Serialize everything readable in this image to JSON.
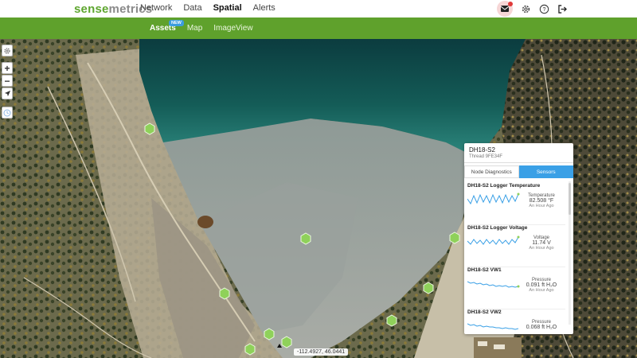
{
  "header": {
    "logo_part1": "sense",
    "logo_part2": "metrics",
    "nav": [
      "Network",
      "Data",
      "Spatial",
      "Alerts"
    ],
    "active_nav": "Spatial"
  },
  "subnav": {
    "items": [
      "Assets",
      "Map",
      "ImageView"
    ],
    "active": "Assets",
    "badge": "NEW"
  },
  "map": {
    "coordinates": "-112.4927, 46.0441",
    "marker_color": "#8fd15a"
  },
  "panel": {
    "title": "DH18-S2",
    "subtitle": "Thread 9FE34F",
    "tabs": [
      "Node Diagnostics",
      "Sensors"
    ],
    "active_tab": "Sensors",
    "sensors": [
      {
        "name": "DH18-S2 Logger Temperature",
        "label": "Temperature",
        "value": "82.508 °F",
        "time": "An Hour Ago"
      },
      {
        "name": "DH18-S2 Logger Voltage",
        "label": "Voltage",
        "value": "11.74 V",
        "time": "An Hour Ago"
      },
      {
        "name": "DH18-S2 VW1",
        "label": "Pressure",
        "value": "0.091 ft H₂O",
        "time": "An Hour Ago"
      },
      {
        "name": "DH18-S2 VW2",
        "label": "Pressure",
        "value": "0.068 ft H₂O",
        "time": ""
      }
    ]
  },
  "colors": {
    "brand_green": "#5fa12c",
    "accent_blue": "#3aa0e6"
  }
}
